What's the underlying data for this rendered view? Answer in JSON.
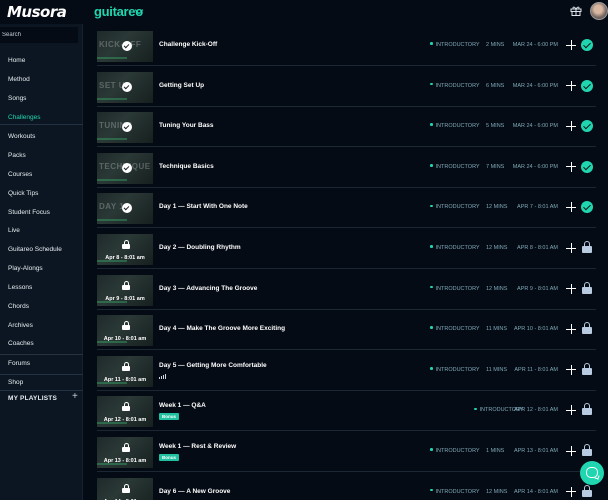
{
  "app": {
    "logo": "Musora",
    "brand": "guitareo"
  },
  "sidebar": {
    "search_placeholder": "Search",
    "items": [
      {
        "label": "Home"
      },
      {
        "label": "Method"
      },
      {
        "label": "Songs"
      },
      {
        "label": "Challenges",
        "active": true
      },
      {
        "label": "Workouts"
      },
      {
        "label": "Packs"
      },
      {
        "label": "Courses"
      },
      {
        "label": "Quick Tips"
      },
      {
        "label": "Student Focus"
      },
      {
        "label": "Live"
      },
      {
        "label": "Guitareo Schedule"
      },
      {
        "label": "Play-Alongs"
      },
      {
        "label": "Lessons"
      },
      {
        "label": "Chords"
      },
      {
        "label": "Archives"
      },
      {
        "label": "Coaches"
      },
      {
        "label": "Forums"
      },
      {
        "label": "Shop"
      }
    ],
    "playlists_label": "MY PLAYLISTS"
  },
  "lessons": [
    {
      "title": "Challenge Kick-Off",
      "thumb_text": "KICK-OFF",
      "level": "INTRODUCTORY",
      "duration": "2 MINS",
      "date": "MAR 24 - 6:00 PM",
      "status": "done"
    },
    {
      "title": "Getting Set Up",
      "thumb_text": "SET UP",
      "level": "INTRODUCTORY",
      "duration": "6 MINS",
      "date": "MAR 24 - 6:00 PM",
      "status": "done"
    },
    {
      "title": "Tuning Your Bass",
      "thumb_text": "TUNING",
      "level": "INTRODUCTORY",
      "duration": "5 MINS",
      "date": "MAR 24 - 6:00 PM",
      "status": "done"
    },
    {
      "title": "Technique Basics",
      "thumb_text": "TECHNIQUE",
      "level": "INTRODUCTORY",
      "duration": "7 MINS",
      "date": "MAR 24 - 6:00 PM",
      "status": "done"
    },
    {
      "title": "Day 1 — Start With One Note",
      "thumb_text": "DAY 1",
      "level": "INTRODUCTORY",
      "duration": "12 MINS",
      "date": "APR 7 - 8:01 AM",
      "status": "done"
    },
    {
      "title": "Day 2 — Doubling Rhythm",
      "thumb_date": "Apr 8 - 8:01 am",
      "level": "INTRODUCTORY",
      "duration": "12 MINS",
      "date": "APR 8 - 8:01 AM",
      "status": "locked"
    },
    {
      "title": "Day 3 — Advancing The Groove",
      "thumb_date": "Apr 9 - 8:01 am",
      "level": "INTRODUCTORY",
      "duration": "12 MINS",
      "date": "APR 9 - 8:01 AM",
      "status": "locked"
    },
    {
      "title": "Day 4 — Make The Groove More Exciting",
      "thumb_date": "Apr 10 - 8:01 am",
      "level": "INTRODUCTORY",
      "duration": "11 MINS",
      "date": "APR 10 - 8:01 AM",
      "status": "locked"
    },
    {
      "title": "Day 5 — Getting More Comfortable",
      "thumb_date": "Apr 11 - 8:01 am",
      "level": "INTRODUCTORY",
      "duration": "11 MINS",
      "date": "APR 11 - 8:01 AM",
      "status": "locked",
      "bars": true
    },
    {
      "title": "Week 1 — Q&A",
      "thumb_date": "Apr 12 - 8:01 am",
      "badge": "Bonus",
      "level": "INTRODUCTORY",
      "duration": "",
      "date": "APR 12 - 8:01 AM",
      "status": "locked"
    },
    {
      "title": "Week 1 — Rest & Review",
      "thumb_date": "Apr 13 - 8:01 am",
      "badge": "Bonus",
      "level": "INTRODUCTORY",
      "duration": "1 MINS",
      "date": "APR 13 - 8:01 AM",
      "status": "locked"
    },
    {
      "title": "Day 6 — A New Groove",
      "thumb_date": "Apr 14 - 8:01 am",
      "level": "INTRODUCTORY",
      "duration": "12 MINS",
      "date": "APR 14 - 8:01 AM",
      "status": "locked"
    }
  ],
  "colors": {
    "accent": "#20d6b0",
    "background": "#050b14",
    "sidebar": "#0b1622"
  }
}
